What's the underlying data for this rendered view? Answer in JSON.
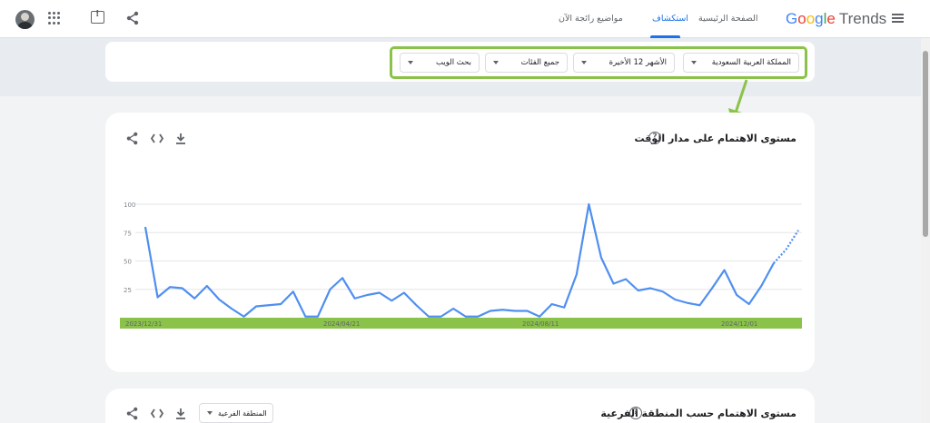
{
  "header": {
    "logo_google": "Google",
    "logo_trends": "Trends",
    "nav": {
      "home": "الصفحة الرئيسية",
      "explore": "استكشاف",
      "trending": "مواضيع رائجة الآن"
    },
    "icons": [
      "menu-icon",
      "share-icon",
      "feedback-icon",
      "apps-icon",
      "avatar"
    ]
  },
  "filters": {
    "region": "المملكة العربية السعودية",
    "time": "الأشهر 12 الأخيرة",
    "category": "جميع الفئات",
    "search_type": "بحث الويب"
  },
  "interest_over_time": {
    "title": "مستوى الاهتمام على مدار الوقت",
    "help": "?"
  },
  "interest_by_region": {
    "title": "مستوى الاهتمام حسب المنطقة الفرعية",
    "help": "?",
    "dropdown": "المنطقة الفرعية"
  },
  "colors": {
    "line": "#4f8ff0",
    "highlight": "#8bc34a",
    "accent": "#1a73e8"
  },
  "chart_data": {
    "type": "line",
    "y_ticks": [
      "100",
      "75",
      "50",
      "25"
    ],
    "x_labels": [
      "2023/12/31",
      "2024/04/21",
      "2024/08/11",
      "2024/12/01"
    ],
    "ylim": [
      0,
      100
    ],
    "grid": true,
    "series": [
      {
        "values": [
          80,
          18,
          27,
          26,
          17,
          28,
          16,
          8,
          1,
          10,
          11,
          12,
          23,
          1,
          1,
          25,
          35,
          17,
          20,
          22,
          15,
          22,
          11,
          1,
          1,
          8,
          1,
          1,
          6,
          7,
          6,
          6,
          1,
          12,
          9,
          38,
          100,
          53,
          30,
          34,
          24,
          26,
          23,
          16,
          13,
          11,
          26,
          42,
          20,
          12,
          28,
          48
        ],
        "partial_tail": [
          48,
          60,
          77
        ]
      }
    ]
  }
}
